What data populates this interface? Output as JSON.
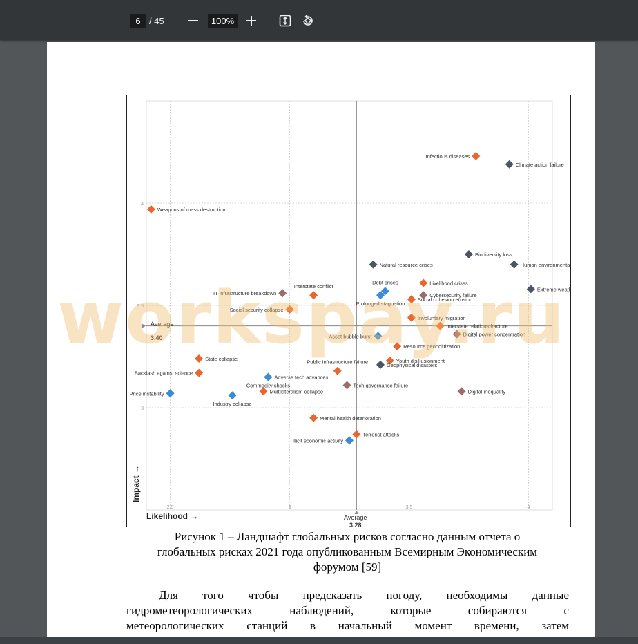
{
  "toolbar": {
    "current_page": "6",
    "page_total": "/ 45",
    "zoom": "100%",
    "zoom_out_icon": "minus-icon",
    "zoom_in_icon": "plus-icon",
    "fit_icon": "fit-page-icon",
    "rotate_icon": "rotate-icon"
  },
  "figure": {
    "ylabel": "Impact →",
    "xlabel": "Likelihood →",
    "avg_impact_label": "Average",
    "avg_impact_value": "3.40",
    "avg_likelihood_label": "Average",
    "avg_likelihood_value": "3.28"
  },
  "chart_data": {
    "type": "scatter",
    "xlabel": "Likelihood →",
    "ylabel": "Impact →",
    "xlim": [
      2.4,
      4.1
    ],
    "ylim": [
      2.5,
      4.5
    ],
    "x_ticks": [
      "2.5",
      "3",
      "3.5",
      "4"
    ],
    "y_ticks": [
      "3",
      "3.5",
      "4"
    ],
    "averages": {
      "x": 3.28,
      "y": 3.4
    },
    "categories_colors": {
      "economic": "#3a8bd9",
      "environmental": "#4a5568",
      "geopolitical": "#e8672e",
      "societal": "#e8672e",
      "technological": "#9c6b6b"
    },
    "points": [
      {
        "label": "Infectious diseases",
        "x": 3.78,
        "y": 4.23,
        "color": "#e8672e"
      },
      {
        "label": "Climate action failure",
        "x": 3.92,
        "y": 4.19,
        "color": "#4a5568"
      },
      {
        "label": "Weapons of mass destruction",
        "x": 2.42,
        "y": 3.97,
        "color": "#e8672e"
      },
      {
        "label": "Biodiversity loss",
        "x": 3.75,
        "y": 3.75,
        "color": "#4a5568"
      },
      {
        "label": "Natural resource crises",
        "x": 3.35,
        "y": 3.7,
        "color": "#4a5568"
      },
      {
        "label": "Human environmental damage",
        "x": 3.94,
        "y": 3.7,
        "color": "#4a5568"
      },
      {
        "label": "Livelihood crises",
        "x": 3.56,
        "y": 3.61,
        "color": "#e8672e"
      },
      {
        "label": "Extreme weather",
        "x": 4.01,
        "y": 3.58,
        "color": "#4a5568"
      },
      {
        "label": "Debt crises",
        "x": 3.4,
        "y": 3.57,
        "color": "#3a8bd9"
      },
      {
        "label": "IT infrastructure breakdown",
        "x": 2.97,
        "y": 3.56,
        "color": "#9c6b6b"
      },
      {
        "label": "Interstate conflict",
        "x": 3.1,
        "y": 3.55,
        "color": "#e8672e"
      },
      {
        "label": "Cybersecurity failure",
        "x": 3.56,
        "y": 3.55,
        "color": "#9c6b6b"
      },
      {
        "label": "Prolonged stagnation",
        "x": 3.38,
        "y": 3.55,
        "color": "#3a8bd9"
      },
      {
        "label": "Social cohesion erosion",
        "x": 3.51,
        "y": 3.53,
        "color": "#e8672e"
      },
      {
        "label": "Social security collapse",
        "x": 3.0,
        "y": 3.48,
        "color": "#e8672e"
      },
      {
        "label": "Involuntary migration",
        "x": 3.51,
        "y": 3.44,
        "color": "#e8672e"
      },
      {
        "label": "Interstate relations fracture",
        "x": 3.63,
        "y": 3.4,
        "color": "#e8672e"
      },
      {
        "label": "Digital power concentration",
        "x": 3.7,
        "y": 3.36,
        "color": "#9c6b6b"
      },
      {
        "label": "Asset bubble burst",
        "x": 3.37,
        "y": 3.35,
        "color": "#3a8bd9"
      },
      {
        "label": "Resource geopolitization",
        "x": 3.45,
        "y": 3.3,
        "color": "#e8672e"
      },
      {
        "label": "State collapse",
        "x": 2.62,
        "y": 3.24,
        "color": "#e8672e"
      },
      {
        "label": "Youth disillusionment",
        "x": 3.42,
        "y": 3.23,
        "color": "#e8672e"
      },
      {
        "label": "Geophysical disasters",
        "x": 3.38,
        "y": 3.21,
        "color": "#4a5568"
      },
      {
        "label": "Public infrastructure failure",
        "x": 3.2,
        "y": 3.18,
        "color": "#e8672e"
      },
      {
        "label": "Backlash against science",
        "x": 2.62,
        "y": 3.17,
        "color": "#e8672e"
      },
      {
        "label": "Adverse tech advances",
        "x": 2.91,
        "y": 3.15,
        "color": "#9c6b6b"
      },
      {
        "label": "Commodity shocks",
        "x": 2.91,
        "y": 3.15,
        "color": "#3a8bd9"
      },
      {
        "label": "Tech governance failure",
        "x": 3.24,
        "y": 3.11,
        "color": "#9c6b6b"
      },
      {
        "label": "Price instability",
        "x": 2.5,
        "y": 3.07,
        "color": "#3a8bd9"
      },
      {
        "label": "Multilateralism collapse",
        "x": 2.89,
        "y": 3.08,
        "color": "#e8672e"
      },
      {
        "label": "Industry collapse",
        "x": 2.76,
        "y": 3.06,
        "color": "#3a8bd9"
      },
      {
        "label": "Digital inequality",
        "x": 3.72,
        "y": 3.08,
        "color": "#9c6b6b"
      },
      {
        "label": "Mental health deterioration",
        "x": 3.1,
        "y": 2.95,
        "color": "#e8672e"
      },
      {
        "label": "Terrorist attacks",
        "x": 3.28,
        "y": 2.87,
        "color": "#e8672e"
      },
      {
        "label": "Illicit economic activity",
        "x": 3.25,
        "y": 2.84,
        "color": "#3a8bd9"
      }
    ]
  },
  "caption": {
    "line1": "Рисунок 1 – Ландшафт глобальных рисков согласно данным отчета о",
    "line2": "глобальных рисках 2021 года опубликованным Всемирным Экономическим",
    "line3": "форумом [59]"
  },
  "paragraph": {
    "line1": "Для того чтобы предсказать погоду, необходимы данные",
    "line2": "гидрометеорологических наблюдений, которые собираются с",
    "line3": "метеорологических станций в начальный момент времени, затем"
  },
  "watermark": "workspay.ru"
}
